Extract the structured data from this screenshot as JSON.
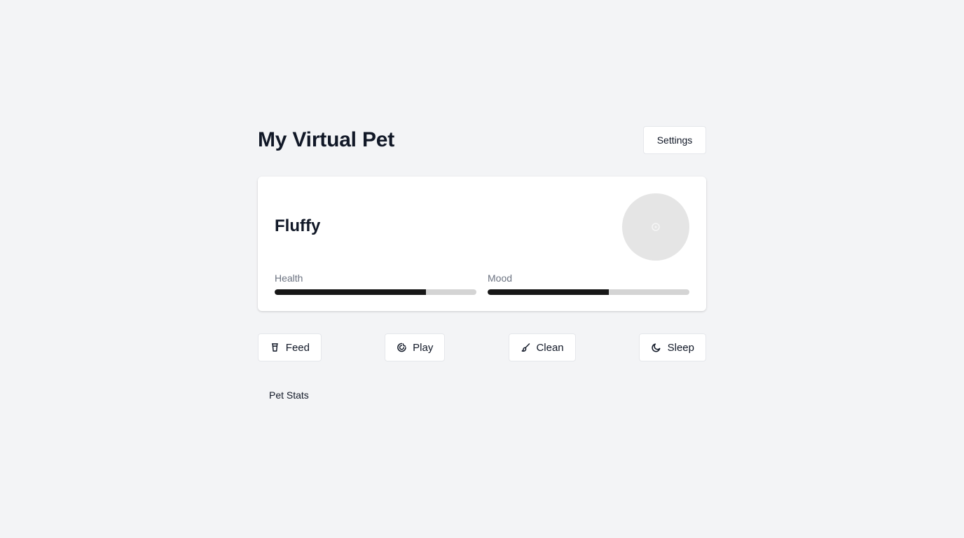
{
  "header": {
    "title": "My Virtual Pet",
    "settings_label": "Settings"
  },
  "pet": {
    "name": "Fluffy",
    "avatar_icon": "pet-placeholder-icon",
    "stats": [
      {
        "label": "Health",
        "value": 0.75
      },
      {
        "label": "Mood",
        "value": 0.6
      }
    ]
  },
  "actions": [
    {
      "label": "Feed",
      "icon": "cup-icon"
    },
    {
      "label": "Play",
      "icon": "toy-icon"
    },
    {
      "label": "Clean",
      "icon": "brush-icon"
    },
    {
      "label": "Sleep",
      "icon": "moon-icon"
    }
  ],
  "section": {
    "pet_stats_label": "Pet Stats"
  },
  "colors": {
    "background": "#f3f4f6",
    "bar_fill": "#171717",
    "bar_track": "#d4d4d4",
    "avatar_bg": "#e5e5e5"
  }
}
